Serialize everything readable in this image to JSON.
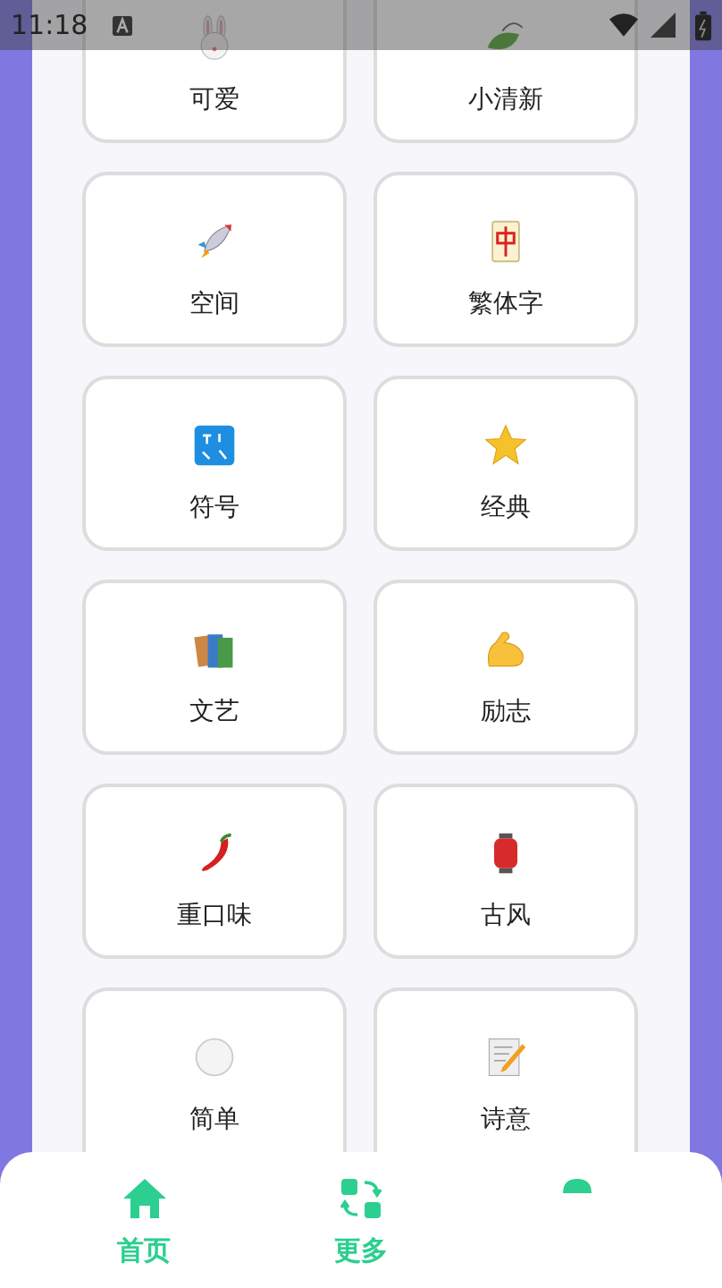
{
  "status_bar": {
    "time": "11:18"
  },
  "categories": [
    {
      "label": "可爱"
    },
    {
      "label": "小清新"
    },
    {
      "label": "空间"
    },
    {
      "label": "繁体字"
    },
    {
      "label": "符号"
    },
    {
      "label": "经典"
    },
    {
      "label": "文艺"
    },
    {
      "label": "励志"
    },
    {
      "label": "重口味"
    },
    {
      "label": "古风"
    },
    {
      "label": "简单"
    },
    {
      "label": "诗意"
    }
  ],
  "nav": [
    {
      "label": "首页"
    },
    {
      "label": "更多"
    }
  ]
}
